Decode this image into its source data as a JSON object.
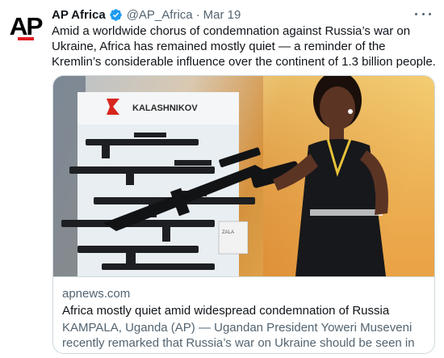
{
  "account": {
    "avatar_text": "AP",
    "name": "AP Africa",
    "handle": "@AP_Africa",
    "separator": "·",
    "date": "Mar 19",
    "verified_color": "#1d9bf0",
    "avatar_accent": "#e21b22"
  },
  "tweet": {
    "text": "Amid a worldwide chorus of condemnation against Russia’s war on Ukraine, Africa has remained mostly quiet — a reminder of the Kremlin’s considerable influence over the continent of 1.3 billion people."
  },
  "card": {
    "image_sign": "KALASHNIKOV",
    "image_sign_small": "ZALA",
    "domain": "apnews.com",
    "title": "Africa mostly quiet amid widespread condemnation of Russia",
    "description": "KAMPALA, Uganda (AP) — Ugandan President Yoweri Museveni recently remarked that Russia’s war on Ukraine should be seen in the ..."
  },
  "icons": {
    "verified": "verified-badge-icon",
    "more": "more-options-icon",
    "brand_logo": "kalashnikov-logo-icon"
  }
}
